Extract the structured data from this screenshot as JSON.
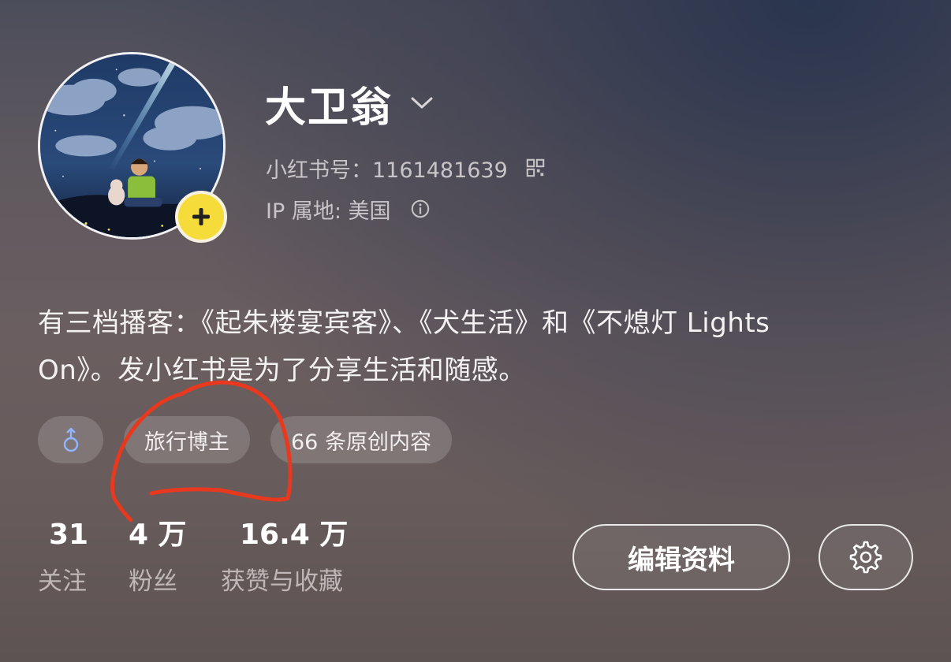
{
  "profile": {
    "name": "大卫翁",
    "id_text": "小红书号：1161481639",
    "ip_text": "IP 属地: 美国",
    "bio_line1": "有三档播客：《起朱楼宴宾客》、《犬生活》和《不熄灯 Lights",
    "bio_line2": "On》。发小红书是为了分享生活和随感。"
  },
  "tags": {
    "gender_icon": "male-symbol-icon",
    "tag1": "旅行博主",
    "tag2": "66 条原创内容"
  },
  "stats": [
    {
      "value": "31",
      "label": "关注"
    },
    {
      "value": "4 万",
      "label": "粉丝"
    },
    {
      "value": "16.4 万",
      "label": "获赞与收藏"
    }
  ],
  "buttons": {
    "edit_profile": "编辑资料",
    "settings_icon": "gear-icon"
  },
  "colors": {
    "add_badge": "#f5dc3a",
    "annotation": "#e8391e",
    "gender_icon": "#8fb6ff"
  }
}
